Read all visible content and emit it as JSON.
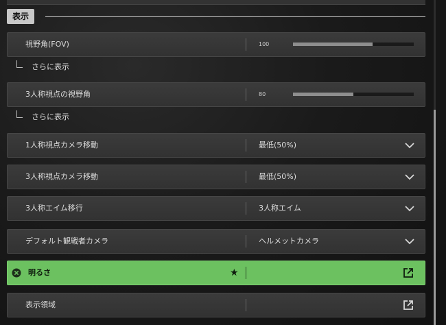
{
  "section": {
    "title": "表示"
  },
  "settings": {
    "fov": {
      "label": "視野角(FOV)",
      "value": "100",
      "fraction": 0.66
    },
    "fov_more": "さらに表示",
    "third_fov": {
      "label": "3人称視点の視野角",
      "value": "80",
      "fraction": 0.5
    },
    "third_fov_more": "さらに表示",
    "fp_camera": {
      "label": "1人称視点カメラ移動",
      "value": "最低(50%)"
    },
    "tp_camera": {
      "label": "3人称視点カメラ移動",
      "value": "最低(50%)"
    },
    "tp_aim": {
      "label": "3人称エイム移行",
      "value": "3人称エイム"
    },
    "spectator": {
      "label": "デフォルト観戦者カメラ",
      "value": "ヘルメットカメラ"
    },
    "brightness": {
      "label": "明るさ",
      "star": "★"
    },
    "display_area": {
      "label": "表示領域"
    }
  },
  "colors": {
    "highlight": "#6cc160",
    "slider_fill": "#8e8e8e",
    "row_bg": "#363636"
  },
  "icons": {
    "clear": "clear-circle-icon",
    "chevron": "chevron-down-icon",
    "external": "external-link-icon"
  }
}
